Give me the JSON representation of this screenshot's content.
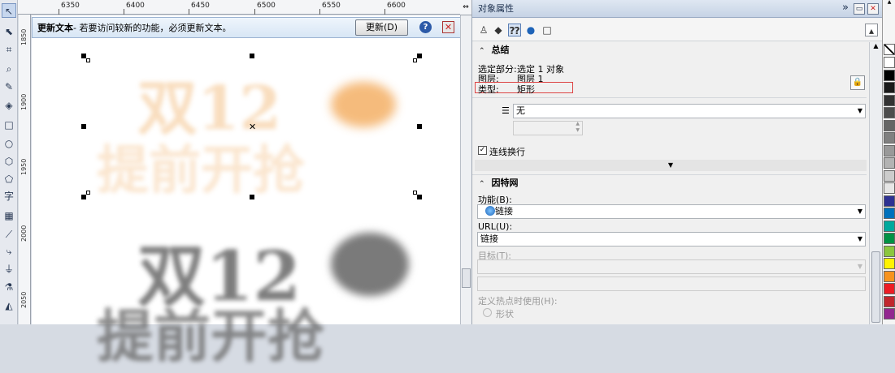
{
  "ruler": {
    "top": [
      "6350",
      "6400",
      "6450",
      "6500",
      "6550",
      "6600"
    ],
    "left": [
      "1850",
      "1900",
      "1950",
      "2000",
      "2050"
    ]
  },
  "notify": {
    "title": "更新文本",
    "message": " - 若要访问较新的功能，必须更新文本。",
    "button": "更新(D)",
    "help": "?",
    "close": "✕"
  },
  "canvas": {
    "art_line1": "双12",
    "art_line2": "提前开抢"
  },
  "panel": {
    "title": "对象属性",
    "title_buttons": [
      "»",
      "▭",
      "✕"
    ],
    "summary": {
      "heading": "总结",
      "selected_label": "选定部分:",
      "selected_value": "选定 1 对象",
      "layer_label": "图层:",
      "layer_value": "图层 1",
      "type_label": "类型:",
      "type_value": "矩形"
    },
    "wrap": {
      "value": "无",
      "checkbox_label": "连线换行",
      "checked": true
    },
    "internet": {
      "heading": "因特网",
      "function_label": "功能(B):",
      "function_value": "链接",
      "url_label": "URL(U):",
      "url_value": "链接",
      "target_label": "目标(T):",
      "hotspot_label": "定义热点时使用(H):",
      "shape_label": "形状"
    }
  },
  "palette": [
    "#ffffff",
    "#000000",
    "#1a1a1a",
    "#333333",
    "#4d4d4d",
    "#666666",
    "#808080",
    "#999999",
    "#b3b3b3",
    "#cccccc",
    "#e6e6e6",
    "#2e3192",
    "#0071bc",
    "#00a99d",
    "#009245",
    "#8cc63f",
    "#fff200",
    "#f7931e",
    "#ed1c24",
    "#c1272d",
    "#93278f",
    "#f26522",
    "#f49ac1",
    "#8c6239",
    "#fbb03b",
    "#c69c6d"
  ],
  "colors": {
    "accent": "#2c5aa8",
    "highlight": "#dd4444",
    "art_orange": "#f4b066",
    "art_grey": "#707070"
  }
}
